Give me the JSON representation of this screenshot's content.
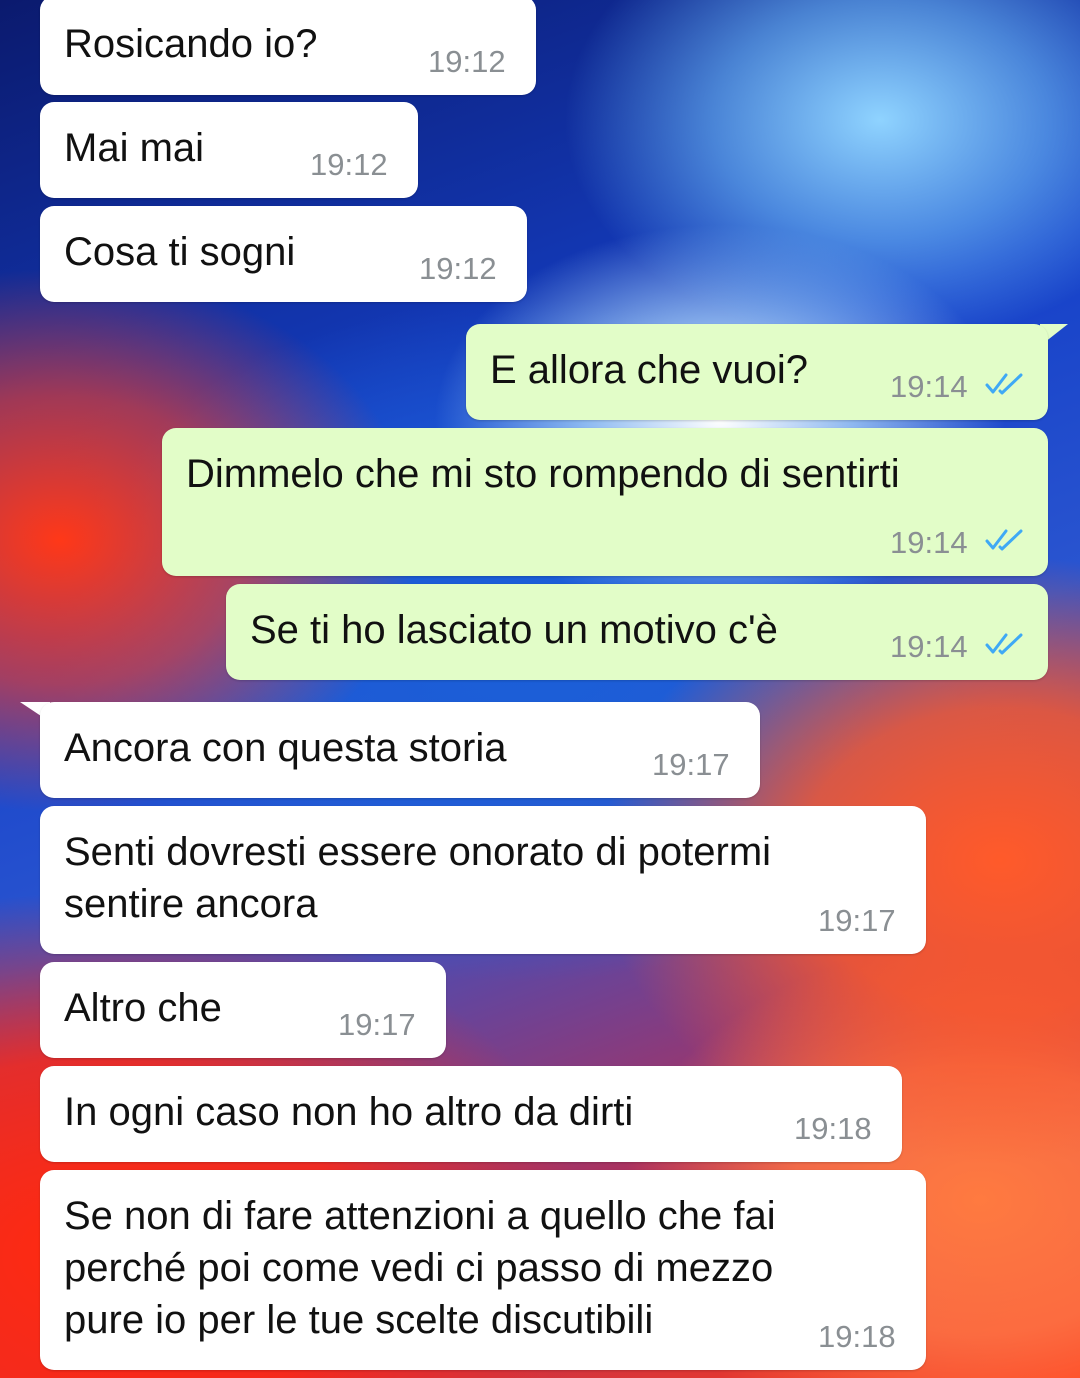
{
  "colors": {
    "incoming_bubble": "#ffffff",
    "outgoing_bubble": "#e2fdc8",
    "timestamp": "#8a8f93",
    "read_ticks": "#3fa9f5"
  },
  "messages": [
    {
      "direction": "incoming",
      "text": "Rosicando io?",
      "time": "19:12"
    },
    {
      "direction": "incoming",
      "text": "Mai mai",
      "time": "19:12"
    },
    {
      "direction": "incoming",
      "text": "Cosa ti sogni",
      "time": "19:12"
    },
    {
      "direction": "outgoing",
      "text": "E allora che vuoi?",
      "time": "19:14",
      "status": "read-double-check-icon"
    },
    {
      "direction": "outgoing",
      "text": "Dimmelo che mi sto rompendo di sentirti",
      "time": "19:14",
      "status": "read-double-check-icon"
    },
    {
      "direction": "outgoing",
      "text": "Se ti ho lasciato un motivo c'è",
      "time": "19:14",
      "status": "read-double-check-icon"
    },
    {
      "direction": "incoming",
      "text": "Ancora con questa storia",
      "time": "19:17"
    },
    {
      "direction": "incoming",
      "text": "Senti dovresti essere onorato di potermi\nsentire ancora",
      "time": "19:17"
    },
    {
      "direction": "incoming",
      "text": "Altro che",
      "time": "19:17"
    },
    {
      "direction": "incoming",
      "text": "In ogni caso non ho altro da dirti",
      "time": "19:18"
    },
    {
      "direction": "incoming",
      "text": "Se non di fare attenzioni a quello che fai\nperché poi come vedi ci passo di mezzo\npure io per le tue scelte discutibili",
      "time": "19:18"
    }
  ]
}
